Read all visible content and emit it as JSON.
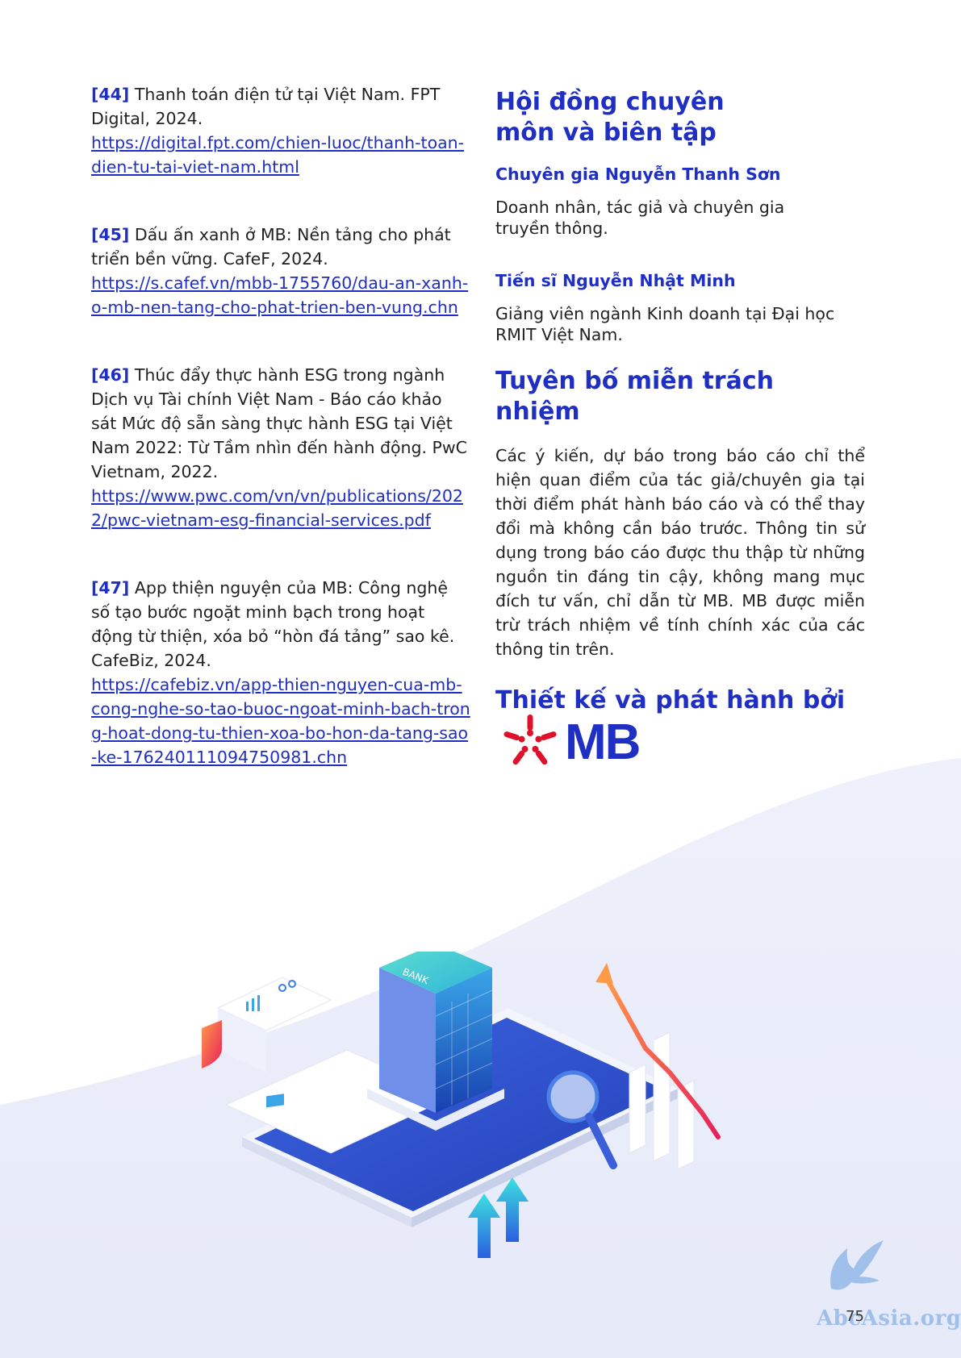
{
  "references": [
    {
      "num": "[44]",
      "text": "Thanh toán điện tử tại Việt Nam. FPT Digital, 2024.",
      "url": "https://digital.fpt.com/chien-luoc/thanh-toan-dien-tu-tai-viet-nam.html"
    },
    {
      "num": "[45]",
      "text": "Dấu ấn xanh ở MB: Nền tảng cho phát triển bền vững. CafeF, 2024.",
      "url": "https://s.cafef.vn/mbb-1755760/dau-an-xanh-o-mb-nen-tang-cho-phat-trien-ben-vung.chn"
    },
    {
      "num": "[46]",
      "text": "Thúc đẩy thực hành ESG trong ngành Dịch vụ Tài chính Việt Nam - Báo cáo khảo sát Mức độ sẵn sàng thực hành ESG tại Việt Nam 2022: Từ Tầm nhìn đến hành động. PwC Vietnam, 2022.",
      "url": "https://www.pwc.com/vn/vn/publications/2022/pwc-vietnam-esg-financial-services.pdf"
    },
    {
      "num": "[47]",
      "text": "App thiện nguyện của MB: Công nghệ số tạo bước ngoặt minh bạch trong hoạt động từ thiện, xóa bỏ “hòn đá tảng” sao kê. CafeBiz, 2024.",
      "url": "https://cafebiz.vn/app-thien-nguyen-cua-mb-cong-nghe-so-tao-buoc-ngoat-minh-bach-trong-hoat-dong-tu-thien-xoa-bo-hon-da-tang-sao-ke-176240111094750981.chn"
    }
  ],
  "board": {
    "title": "Hội đồng chuyên môn và biên tập",
    "members": [
      {
        "name": "Chuyên gia Nguyễn Thanh Sơn",
        "desc": "Doanh nhân, tác giả và chuyên gia truyền thông."
      },
      {
        "name": "Tiến sĩ Nguyễn Nhật Minh",
        "desc": "Giảng viên ngành Kinh doanh tại Đại học RMIT Việt Nam."
      }
    ]
  },
  "disclaimer": {
    "title": "Tuyên bố miễn trách nhiệm",
    "body": "Các ý kiến, dự báo trong báo cáo chỉ thể hiện quan điểm của tác giả/chuyên gia tại thời điểm phát hành báo cáo và có thể thay đổi mà không cần báo trước. Thông tin sử dụng trong báo cáo được thu thập từ những nguồn tin đáng tin cậy, không mang mục đích tư vấn, chỉ dẫn từ MB. MB được miễn trừ trách nhiệm về tính chính xác của các thông tin trên."
  },
  "publisher": {
    "title": "Thiết kế và phát hành bởi",
    "logo_text": "MB"
  },
  "illustration": {
    "building_label": "BANK"
  },
  "page_number": "75",
  "watermark": "AbcAsia.org",
  "colors": {
    "brand_blue": "#1f2fc4",
    "logo_red": "#e0102b"
  }
}
